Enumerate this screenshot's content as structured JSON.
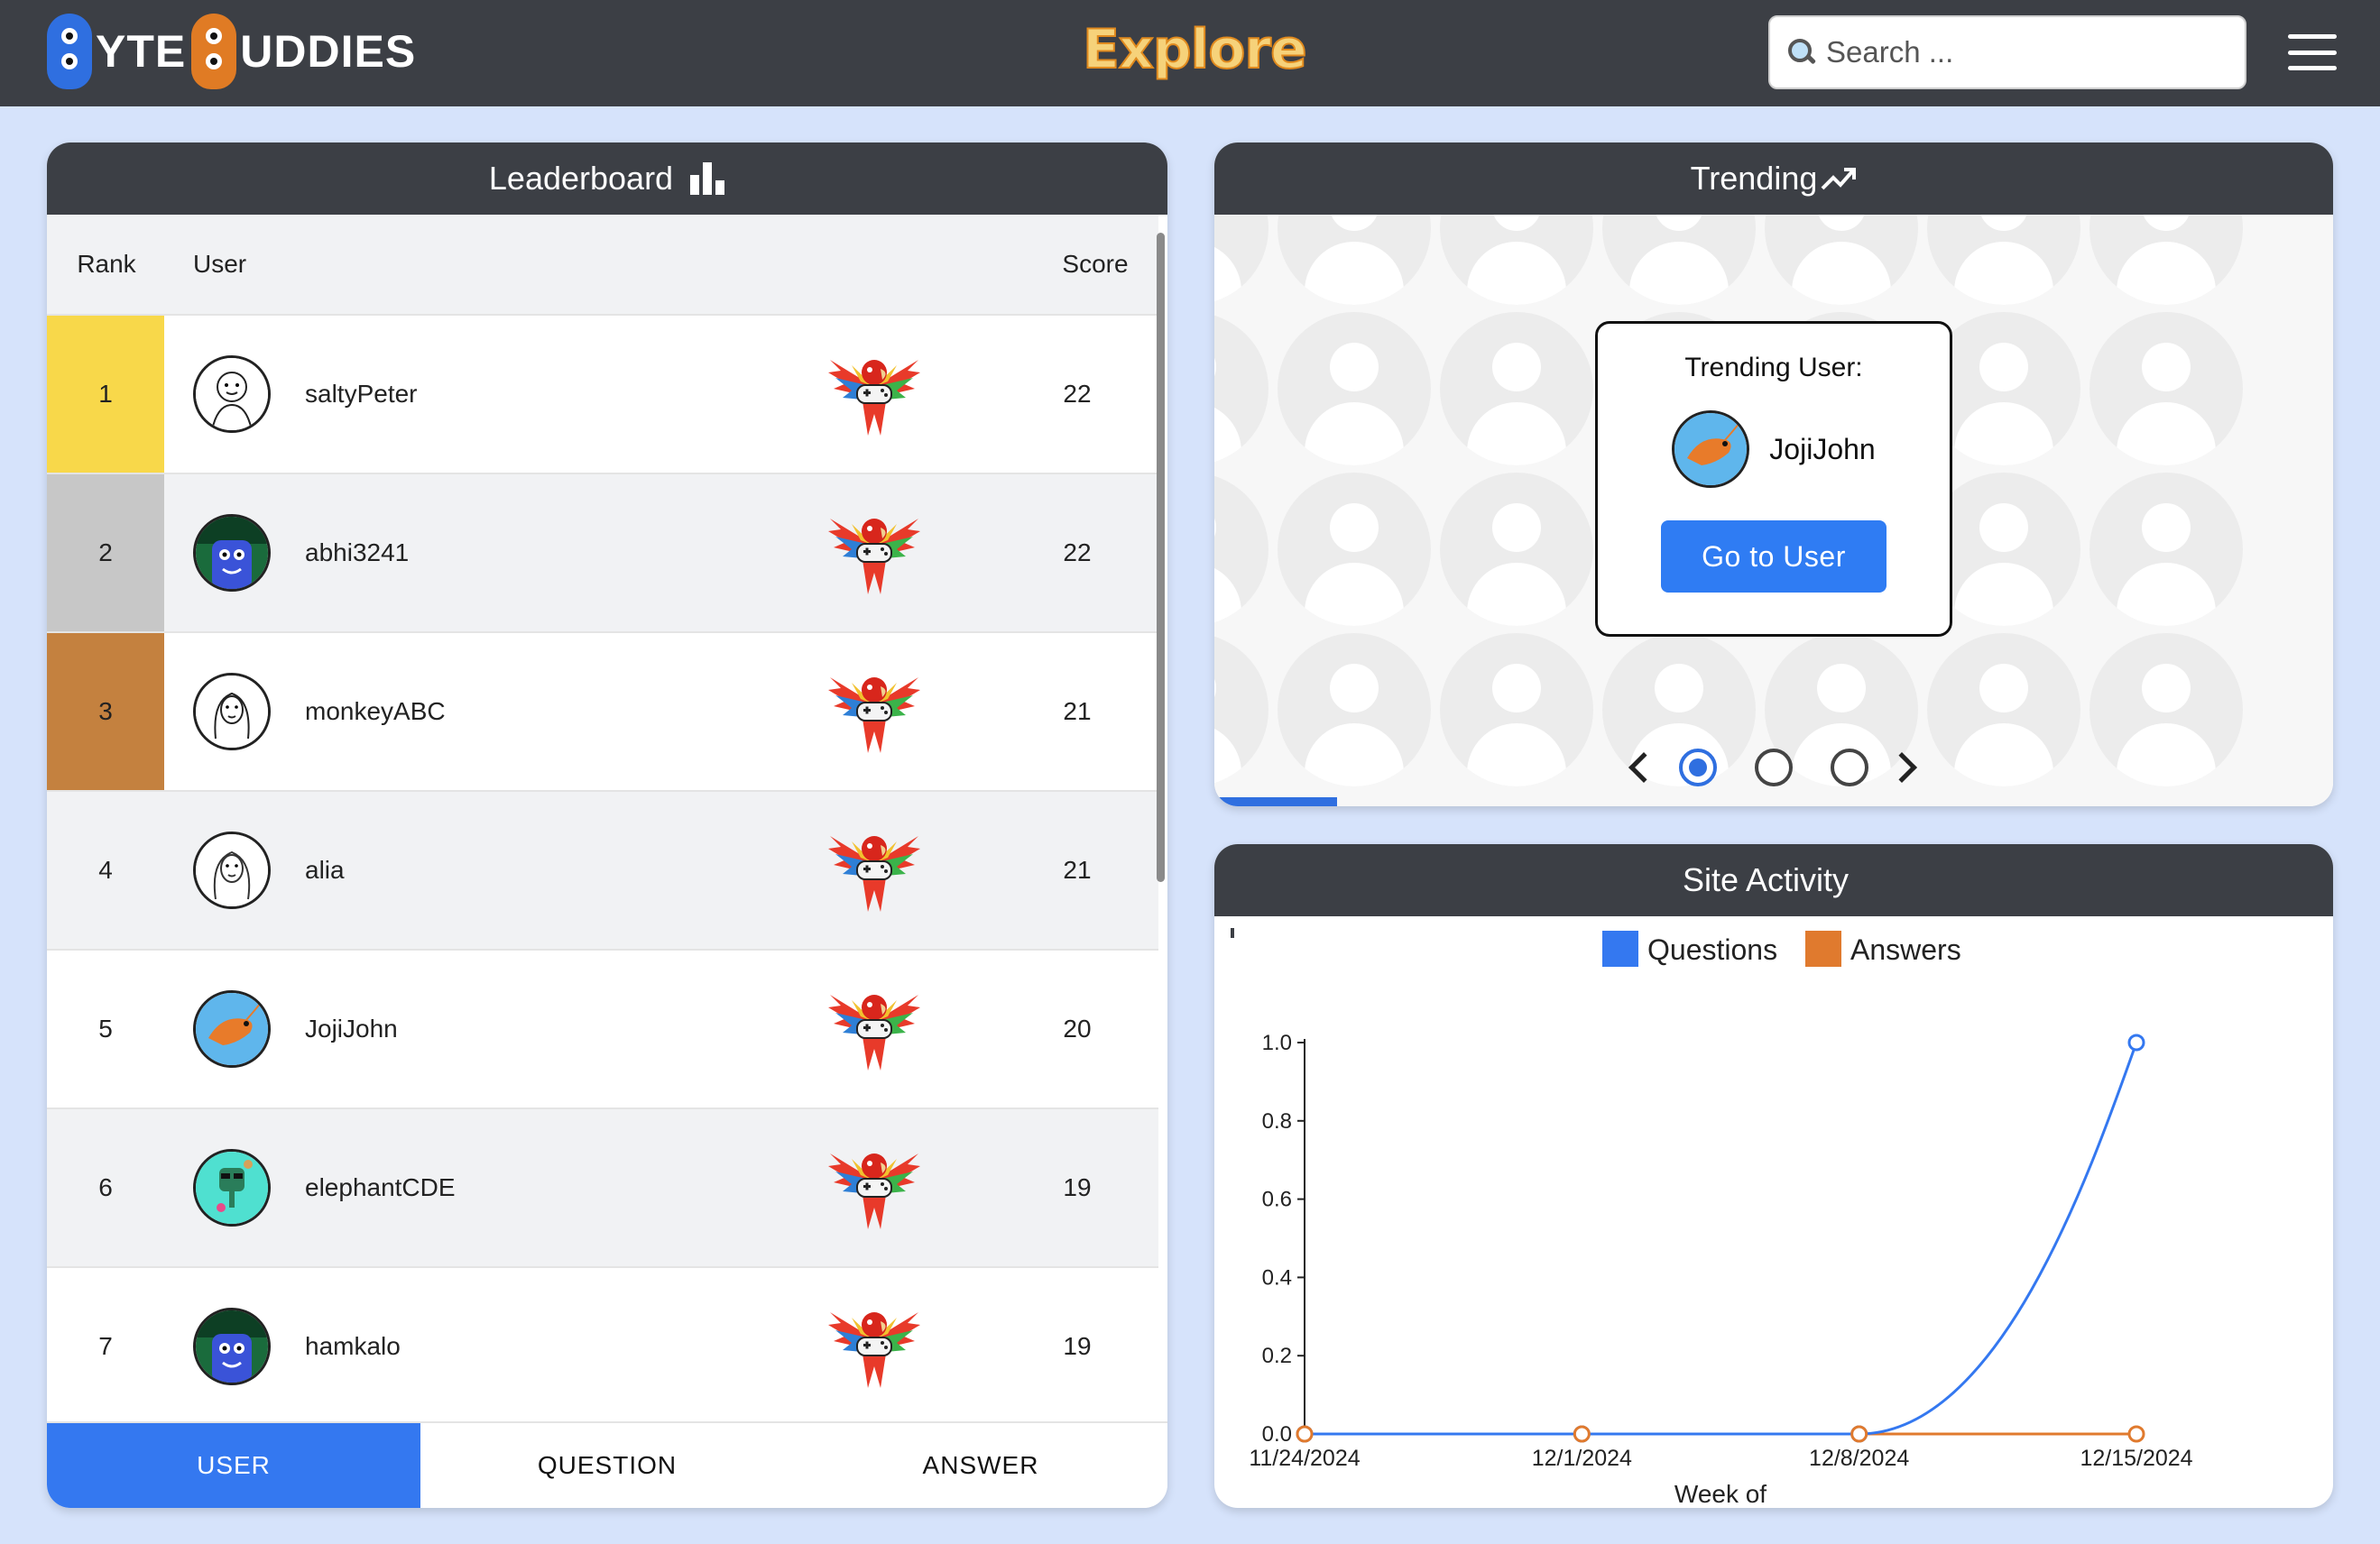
{
  "header": {
    "logo_text_1": "YTE",
    "logo_text_2": "UDDIES",
    "page_title": "Explore",
    "search_placeholder": "Search ..."
  },
  "leaderboard": {
    "title": "Leaderboard",
    "columns": {
      "rank": "Rank",
      "user": "User",
      "score": "Score"
    },
    "rows": [
      {
        "rank": "1",
        "user": "saltyPeter",
        "score": "22",
        "rank_color": "#f8d84a"
      },
      {
        "rank": "2",
        "user": "abhi3241",
        "score": "22",
        "rank_color": "#c7c7c7"
      },
      {
        "rank": "3",
        "user": "monkeyABC",
        "score": "21",
        "rank_color": "#c4813f"
      },
      {
        "rank": "4",
        "user": "alia",
        "score": "21"
      },
      {
        "rank": "5",
        "user": "JojiJohn",
        "score": "20"
      },
      {
        "rank": "6",
        "user": "elephantCDE",
        "score": "19"
      },
      {
        "rank": "7",
        "user": "hamkalo",
        "score": "19"
      }
    ],
    "tabs": [
      "USER",
      "QUESTION",
      "ANSWER"
    ],
    "active_tab": "USER"
  },
  "trending": {
    "title": "Trending",
    "card_label": "Trending User:",
    "user": "JojiJohn",
    "button_label": "Go to User",
    "slides": 3,
    "active_slide": 1,
    "progress": 0.11
  },
  "activity": {
    "title": "Site Activity",
    "chart_data": {
      "type": "line",
      "x": [
        "11/24/2024",
        "12/1/2024",
        "12/8/2024",
        "12/15/2024"
      ],
      "series": [
        {
          "name": "Questions",
          "values": [
            0,
            0,
            0,
            1
          ],
          "color": "#3478f0"
        },
        {
          "name": "Answers",
          "values": [
            0,
            0,
            0,
            0
          ],
          "color": "#e07a2e"
        }
      ],
      "xlabel": "Week of",
      "ylabel": "",
      "ylim": [
        0,
        1
      ],
      "yticks": [
        "0.0",
        "0.2",
        "0.4",
        "0.6",
        "0.8",
        "1.0"
      ],
      "legend": "top"
    }
  },
  "colors": {
    "accent": "#3478f0",
    "header_bg": "#3c3f45",
    "page_bg": "#d6e3fb"
  }
}
